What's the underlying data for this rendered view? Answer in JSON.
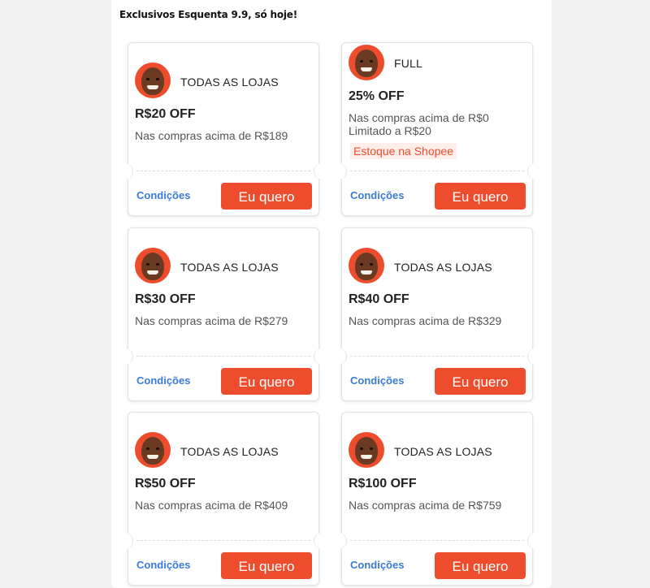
{
  "page": {
    "heading": "Exclusivos Esquenta 9.9, só hoje!"
  },
  "colors": {
    "accent": "#ee4d2d",
    "link": "#3a7bd5"
  },
  "coupons": [
    {
      "store": "TODAS AS LOJAS",
      "title": "R$20 OFF",
      "desc": "Nas compras acima de R$189",
      "cond": "Condições",
      "cta": "Eu quero"
    },
    {
      "store": "FULL",
      "title": "25% OFF",
      "desc": "Nas compras acima de R$0",
      "limit": "Limitado a R$20",
      "tag": "Estoque na Shopee",
      "cond": "Condições",
      "cta": "Eu quero"
    },
    {
      "store": "TODAS AS LOJAS",
      "title": "R$30 OFF",
      "desc": "Nas compras acima de R$279",
      "cond": "Condições",
      "cta": "Eu quero"
    },
    {
      "store": "TODAS AS LOJAS",
      "title": "R$40 OFF",
      "desc": "Nas compras acima de R$329",
      "cond": "Condições",
      "cta": "Eu quero"
    },
    {
      "store": "TODAS AS LOJAS",
      "title": "R$50 OFF",
      "desc": "Nas compras acima de R$409",
      "cond": "Condições",
      "cta": "Eu quero"
    },
    {
      "store": "TODAS AS LOJAS",
      "title": "R$100 OFF",
      "desc": "Nas compras acima de R$759",
      "cond": "Condições",
      "cta": "Eu quero"
    }
  ]
}
